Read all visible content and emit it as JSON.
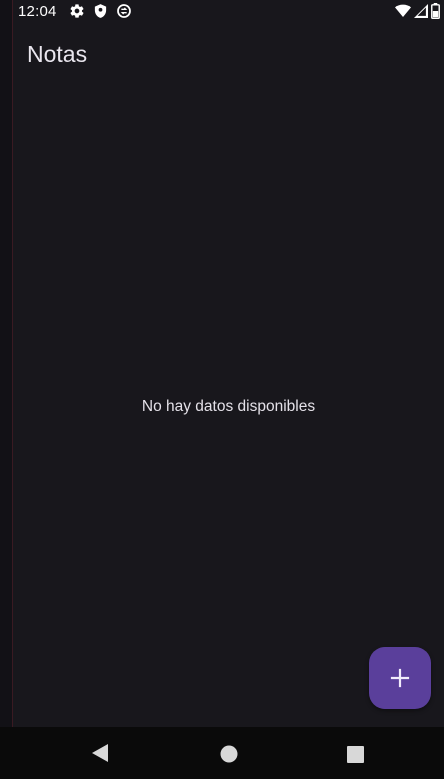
{
  "status_bar": {
    "time": "12:04",
    "icons_left": [
      "settings-icon",
      "shield-icon",
      "sync-icon"
    ],
    "icons_right": [
      "wifi-icon",
      "cell-signal-icon",
      "battery-icon"
    ]
  },
  "app_bar": {
    "title": "Notas"
  },
  "main": {
    "empty_message": "No hay datos disponibles"
  },
  "fab": {
    "icon": "plus-icon",
    "color": "#5a3f9b"
  },
  "nav_bar": {
    "buttons": [
      "back-icon",
      "home-icon",
      "recents-icon"
    ]
  },
  "colors": {
    "background": "#18171c",
    "text_primary": "#e9e6ee",
    "accent": "#5a3f9b"
  }
}
